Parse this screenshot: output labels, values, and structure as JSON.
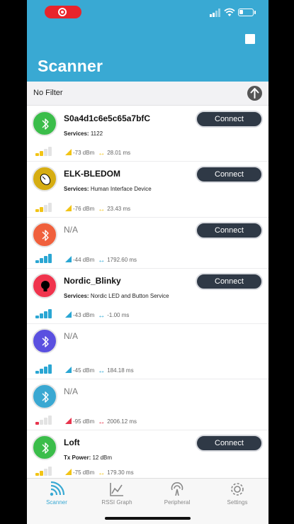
{
  "header": {
    "title": "Scanner"
  },
  "filter": {
    "label": "No Filter"
  },
  "devices": [
    {
      "name": "S0a4d1c6e5c65a7bfC",
      "services_label": "Services:",
      "services": "1122",
      "rssi": "-73 dBm",
      "interval": "28.01 ms",
      "connect_label": "Connect",
      "avatar_color": "#3bbd4a",
      "signal_color": "#f2c416",
      "signal_bars": 2
    },
    {
      "name": "ELK-BLEDOM",
      "services_label": "Services:",
      "services": "Human Interface Device",
      "rssi": "-76 dBm",
      "interval": "23.43 ms",
      "connect_label": "Connect",
      "avatar_color": "#d6ad12",
      "signal_color": "#f2c416",
      "signal_bars": 2
    },
    {
      "name": "N/A",
      "rssi": "-44 dBm",
      "interval": "1792.60 ms",
      "connect_label": "Connect",
      "avatar_color": "#f0603c",
      "signal_color": "#2aa6d3",
      "signal_bars": 4
    },
    {
      "name": "Nordic_Blinky",
      "services_label": "Services:",
      "services": "Nordic LED and Button Service",
      "rssi": "-43 dBm",
      "interval": "-1.00 ms",
      "connect_label": "Connect",
      "avatar_color": "#f0344d",
      "signal_color": "#2aa6d3",
      "signal_bars": 4
    },
    {
      "name": "N/A",
      "rssi": "-45 dBm",
      "interval": "184.18 ms",
      "avatar_color": "#5a50e0",
      "signal_color": "#2aa6d3",
      "signal_bars": 4
    },
    {
      "name": "N/A",
      "rssi": "-95 dBm",
      "interval": "2006.12 ms",
      "avatar_color": "#3aa8d2",
      "signal_color": "#e7344d",
      "signal_bars": 1
    },
    {
      "name": "Loft",
      "services_label": "Tx Power:",
      "services": "12 dBm",
      "rssi": "-75 dBm",
      "interval": "179.30 ms",
      "connect_label": "Connect",
      "avatar_color": "#3bbd4a",
      "signal_color": "#f2c416",
      "signal_bars": 2
    }
  ],
  "tabs": [
    {
      "label": "Scanner",
      "icon": "scanner-icon",
      "active": true
    },
    {
      "label": "RSSI Graph",
      "icon": "graph-icon",
      "active": false
    },
    {
      "label": "Peripheral",
      "icon": "peripheral-icon",
      "active": false
    },
    {
      "label": "Settings",
      "icon": "gear-icon",
      "active": false
    }
  ],
  "colors": {
    "accent": "#39a9d3",
    "button": "#2f3946"
  }
}
